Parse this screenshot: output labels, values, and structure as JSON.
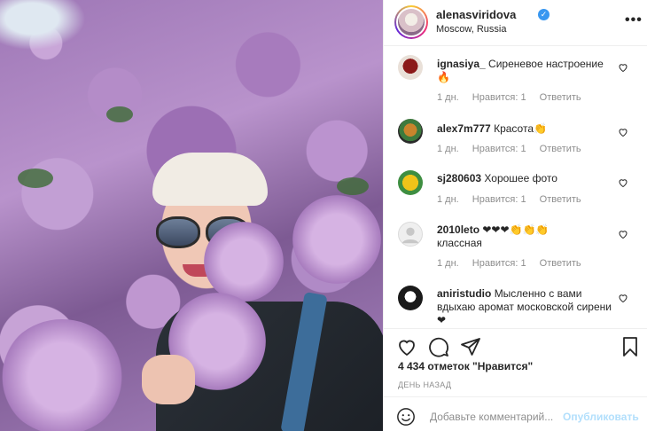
{
  "post": {
    "username": "alenasviridova",
    "location": "Moscow, Russia",
    "verified_icon": "verified-badge-icon",
    "more_icon": "more-options-icon"
  },
  "comments": [
    {
      "user": "ignasiya_",
      "text": "Сиреневое настроение 🔥",
      "time": "1 дн.",
      "likes": "Нравится: 1",
      "reply": "Ответить"
    },
    {
      "user": "alex7m777",
      "text": "Красота👏",
      "time": "1 дн.",
      "likes": "Нравится: 1",
      "reply": "Ответить"
    },
    {
      "user": "sj280603",
      "text": "Хорошее фото",
      "time": "1 дн.",
      "likes": "Нравится: 1",
      "reply": "Ответить"
    },
    {
      "user": "2010leto",
      "text": "❤❤❤👏👏👏 классная",
      "time": "1 дн.",
      "likes": "Нравится: 1",
      "reply": "Ответить"
    },
    {
      "user": "aniristudio",
      "text": "Мысленно с вами вдыхаю аромат московской сирени❤"
    }
  ],
  "actions": {
    "like_icon": "heart-icon",
    "comment_icon": "comment-icon",
    "share_icon": "paper-plane-icon",
    "save_icon": "bookmark-icon"
  },
  "likes_label": "4 434 отметок \"Нравится\"",
  "date_label": "ДЕНЬ НАЗАД",
  "add_comment": {
    "placeholder": "Добавьте комментарий...",
    "publish_label": "Опубликовать"
  },
  "colors": {
    "verified": "#3897f0",
    "muted": "#8e8e8e",
    "publish_disabled": "#b2dffc",
    "text": "#262626"
  }
}
